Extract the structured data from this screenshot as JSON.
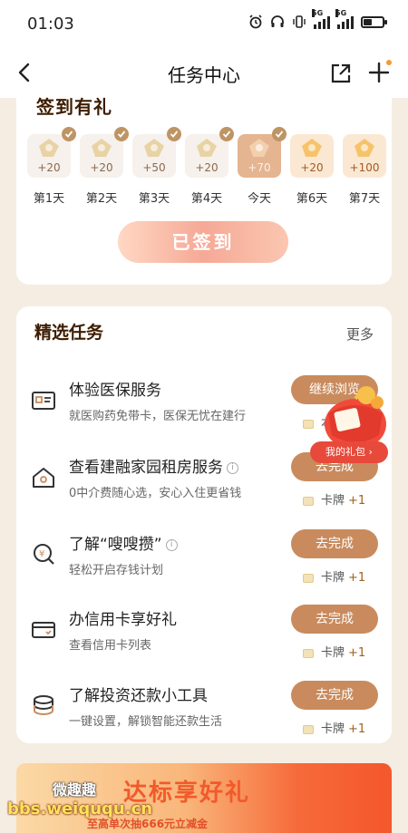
{
  "status_bar": {
    "time": "01:03",
    "net1": "5G",
    "net2": "5G"
  },
  "nav": {
    "title": "任务中心"
  },
  "signin": {
    "title": "签到有礼",
    "days": [
      {
        "label": "第1天",
        "value": "+20",
        "state": "done"
      },
      {
        "label": "第2天",
        "value": "+20",
        "state": "done"
      },
      {
        "label": "第3天",
        "value": "+50",
        "state": "done"
      },
      {
        "label": "第4天",
        "value": "+20",
        "state": "done"
      },
      {
        "label": "今天",
        "value": "+70",
        "state": "today"
      },
      {
        "label": "第6天",
        "value": "+20",
        "state": "future"
      },
      {
        "label": "第7天",
        "value": "+100",
        "state": "future"
      }
    ],
    "button_label": "已签到"
  },
  "tasks": {
    "title": "精选任务",
    "more_label": "更多",
    "items": [
      {
        "name": "体验医保服务",
        "desc": "就医购药免带卡，医保无忧在建行",
        "button": "继续浏览",
        "reward_label": "本次",
        "reward_plus": "",
        "icon": "medical-card-icon",
        "has_info": false
      },
      {
        "name": "查看建融家园租房服务",
        "desc": "0中介费随心选，安心入住更省钱",
        "button": "去完成",
        "reward_label": "卡牌",
        "reward_plus": "+1",
        "icon": "house-icon",
        "has_info": true
      },
      {
        "name": "了解“嗖嗖攒”",
        "desc": "轻松开启存钱计划",
        "button": "去完成",
        "reward_label": "卡牌",
        "reward_plus": "+1",
        "icon": "savings-icon",
        "has_info": true
      },
      {
        "name": "办信用卡享好礼",
        "desc": "查看信用卡列表",
        "button": "去完成",
        "reward_label": "卡牌",
        "reward_plus": "+1",
        "icon": "credit-card-icon",
        "has_info": false
      },
      {
        "name": "了解投资还款小工具",
        "desc": "一键设置，解锁智能还款生活",
        "button": "去完成",
        "reward_label": "卡牌",
        "reward_plus": "+1",
        "icon": "coins-icon",
        "has_info": false
      }
    ]
  },
  "gift": {
    "label": "我的礼包 ›"
  },
  "banner": {
    "title": "达标享好礼",
    "subtitle": "至高单次抽666元立减金"
  },
  "watermark": {
    "line1": "微趣趣",
    "line2": "bbs.weiququ.cn"
  },
  "colors": {
    "accent_button": "#c98b5d",
    "page_bg": "#f5ede2",
    "title_brown": "#3d1c00"
  }
}
